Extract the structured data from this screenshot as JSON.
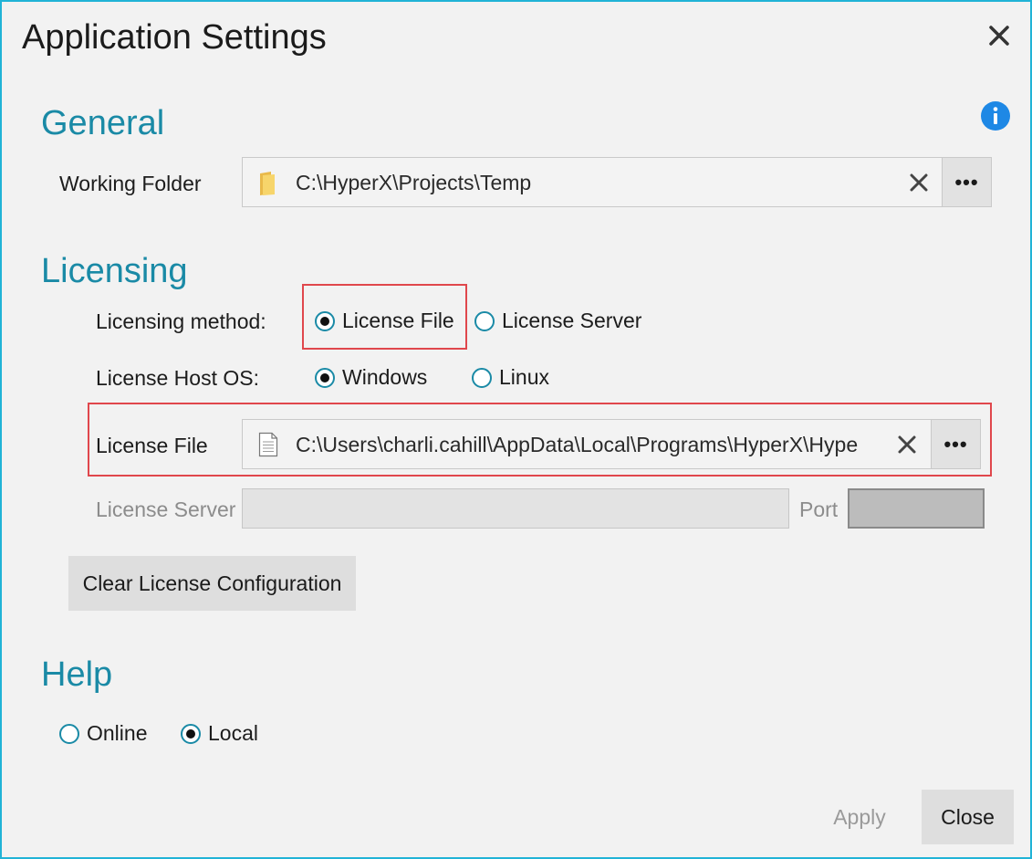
{
  "dialog": {
    "title": "Application Settings",
    "close_icon": "close-icon",
    "info_icon": "info-icon"
  },
  "general": {
    "heading": "General",
    "working_folder": {
      "label": "Working Folder",
      "value": "C:\\HyperX\\Projects\\Temp",
      "icon": "folder-icon",
      "browse_label": "•••"
    }
  },
  "licensing": {
    "heading": "Licensing",
    "method": {
      "label": "Licensing method:",
      "options": [
        "License File",
        "License Server"
      ],
      "selected": "License File"
    },
    "host_os": {
      "label": "License Host OS:",
      "options": [
        "Windows",
        "Linux"
      ],
      "selected": "Windows"
    },
    "license_file": {
      "label": "License File",
      "value": "C:\\Users\\charli.cahill\\AppData\\Local\\Programs\\HyperX\\Hype",
      "icon": "document-icon",
      "browse_label": "•••"
    },
    "license_server": {
      "label": "License Server",
      "value": "",
      "port_label": "Port",
      "port_value": ""
    },
    "clear_button": "Clear License Configuration"
  },
  "help": {
    "heading": "Help",
    "options": [
      "Online",
      "Local"
    ],
    "selected": "Local"
  },
  "footer": {
    "apply_label": "Apply",
    "close_label": "Close"
  },
  "colors": {
    "accent": "#1a8aa6",
    "window_border": "#21b3d6",
    "highlight": "#e0474c",
    "info_blue": "#1e88e5"
  }
}
